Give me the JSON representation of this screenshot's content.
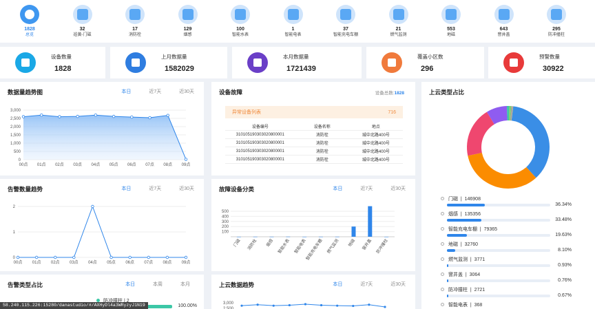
{
  "categories": [
    {
      "value": "1828",
      "label": "总览"
    },
    {
      "value": "32",
      "label": "巡黄-门磁"
    },
    {
      "value": "17",
      "label": "消防栓"
    },
    {
      "value": "129",
      "label": "烟感"
    },
    {
      "value": "100",
      "label": "智能水表"
    },
    {
      "value": "1",
      "label": "智能电表"
    },
    {
      "value": "37",
      "label": "智能充电车棚"
    },
    {
      "value": "21",
      "label": "燃气监测"
    },
    {
      "value": "553",
      "label": "地磁"
    },
    {
      "value": "643",
      "label": "窨井盖"
    },
    {
      "value": "295",
      "label": "防冲撞柱"
    }
  ],
  "stats": [
    {
      "title": "设备数量",
      "value": "1828",
      "color": "#1aa8e6"
    },
    {
      "title": "上月数据量",
      "value": "1582029",
      "color": "#2f7de0"
    },
    {
      "title": "本月数据量",
      "value": "1721439",
      "color": "#6a3fc7"
    },
    {
      "title": "覆盖小区数",
      "value": "296",
      "color": "#f07a3c"
    },
    {
      "title": "预警数量",
      "value": "30922",
      "color": "#e83a3a"
    }
  ],
  "trend": {
    "title": "数据量趋势图",
    "tabs": [
      "本日",
      "近7天",
      "近30天"
    ]
  },
  "fault": {
    "title": "设备故障",
    "total_label": "设备总数:",
    "total": "1828",
    "list_title": "异常设备列表",
    "list_count": "716",
    "headers": [
      "设备编号",
      "设备名称",
      "地点"
    ],
    "rows": [
      [
        "310105190303020800001",
        "消防栓",
        "城中北路400号"
      ],
      [
        "310105190303020800001",
        "消防栓",
        "城中北路400号"
      ],
      [
        "310105190303020800001",
        "消防栓",
        "城中北路400号"
      ],
      [
        "310105190303020800001",
        "消防栓",
        "城中北路400号"
      ]
    ]
  },
  "share": {
    "title": "上云类型占比",
    "items": [
      {
        "name": "门磁",
        "count": "146908",
        "pct": "36.34%",
        "frac": 0.3634,
        "color": "#3a8ee6"
      },
      {
        "name": "烟感",
        "count": "135356",
        "pct": "33.48%",
        "frac": 0.3348,
        "color": "#fb8c00"
      },
      {
        "name": "智能充电车棚",
        "count": "79365",
        "pct": "19.63%",
        "frac": 0.1963,
        "color": "#ef476f"
      },
      {
        "name": "地磁",
        "count": "32760",
        "pct": "8.10%",
        "frac": 0.081,
        "color": "#8f5cf0"
      },
      {
        "name": "燃气监测",
        "count": "3771",
        "pct": "0.93%",
        "frac": 0.0093,
        "color": "#3cc7a6"
      },
      {
        "name": "窨井盖",
        "count": "3064",
        "pct": "0.76%",
        "frac": 0.0076,
        "color": "#7fcf6b"
      },
      {
        "name": "防冲撞柱",
        "count": "2721",
        "pct": "0.67%",
        "frac": 0.0067,
        "color": "#a1a1a1"
      },
      {
        "name": "智能电表",
        "count": "368",
        "pct": "",
        "frac": 0.001,
        "color": "#ffcd38"
      }
    ]
  },
  "alarm": {
    "title": "告警数量趋势",
    "tabs": [
      "本日",
      "近7天",
      "近30天"
    ]
  },
  "faultcat": {
    "title": "故障设备分类",
    "tabs": [
      "本日",
      "近7天",
      "近30天"
    ]
  },
  "alarmtype": {
    "title": "告警类型占比",
    "tabs": [
      "本日",
      "本周",
      "本月"
    ],
    "item_name": "防冲撞柱",
    "item_count": "2",
    "item_pct": "100.00%"
  },
  "cloudtrend": {
    "title": "上云数据趋势",
    "tabs": [
      "本日",
      "近7天",
      "近30天"
    ]
  },
  "url": "58.240.115.226:15280/danastudio/#/AXHyDl4a3WRyzyJ1N19",
  "chart_data": [
    {
      "type": "area",
      "title": "数据量趋势图",
      "x": [
        "00点",
        "01点",
        "02点",
        "03点",
        "04点",
        "05点",
        "06点",
        "07点",
        "08点",
        "09点"
      ],
      "values": [
        2600,
        2700,
        2600,
        2620,
        2700,
        2620,
        2580,
        2540,
        2680,
        20
      ],
      "ylim": [
        0,
        3000
      ],
      "yticks": [
        "0",
        "500",
        "1,000",
        "1,500",
        "2,000",
        "2,500",
        "3,000"
      ]
    },
    {
      "type": "line",
      "title": "告警数量趋势",
      "x": [
        "00点",
        "01点",
        "02点",
        "03点",
        "04点",
        "05点",
        "06点",
        "07点",
        "08点",
        "09点"
      ],
      "values": [
        0,
        0,
        0,
        0,
        2,
        0,
        0,
        0,
        0,
        0
      ],
      "ylim": [
        0,
        2
      ],
      "yticks": [
        "0",
        "1",
        "2"
      ]
    },
    {
      "type": "bar",
      "title": "故障设备分类",
      "categories": [
        "门磁",
        "消防栓",
        "烟感",
        "智能水表",
        "智能电表",
        "智能充电车棚",
        "燃气监测",
        "地磁",
        "窨井盖",
        "防冲撞柱"
      ],
      "values": [
        0,
        1,
        1,
        2,
        0,
        1,
        1,
        200,
        680,
        0
      ],
      "ylim": [
        0,
        500
      ],
      "yticks": [
        "100",
        "200",
        "300",
        "400",
        "500"
      ]
    },
    {
      "type": "line",
      "title": "上云数据趋势",
      "values": [
        2700,
        2740,
        2700,
        2720,
        2760,
        2720,
        2700,
        2690,
        2740,
        2650
      ],
      "yticks": [
        "2,500",
        "3,000"
      ]
    }
  ]
}
